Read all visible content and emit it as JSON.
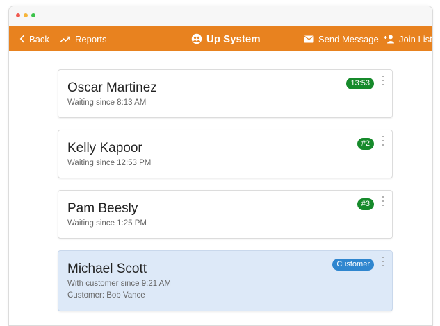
{
  "colors": {
    "topbar": "#e8821f",
    "accent_green": "#168a2b",
    "accent_blue": "#2f86cf",
    "active_card": "#dde9f8",
    "dot_red": "#f05a50",
    "dot_yellow": "#f6b53a",
    "dot_green": "#3cc34a"
  },
  "nav": {
    "back_label": "Back",
    "reports_label": "Reports",
    "title": "Up System",
    "send_message_label": "Send Message",
    "join_list_label": "Join List"
  },
  "queue": [
    {
      "name": "Oscar Martinez",
      "status": "Waiting since 8:13 AM",
      "badge": "13:53",
      "badge_color": "#168a2b"
    },
    {
      "name": "Kelly Kapoor",
      "status": "Waiting since 12:53 PM",
      "badge": "#2",
      "badge_color": "#168a2b"
    },
    {
      "name": "Pam Beesly",
      "status": "Waiting since 1:25 PM",
      "badge": "#3",
      "badge_color": "#168a2b"
    },
    {
      "name": "Michael Scott",
      "status": "With customer since 9:21 AM",
      "customer": "Customer: Bob Vance",
      "badge": "Customer",
      "badge_color": "#2f86cf"
    }
  ]
}
